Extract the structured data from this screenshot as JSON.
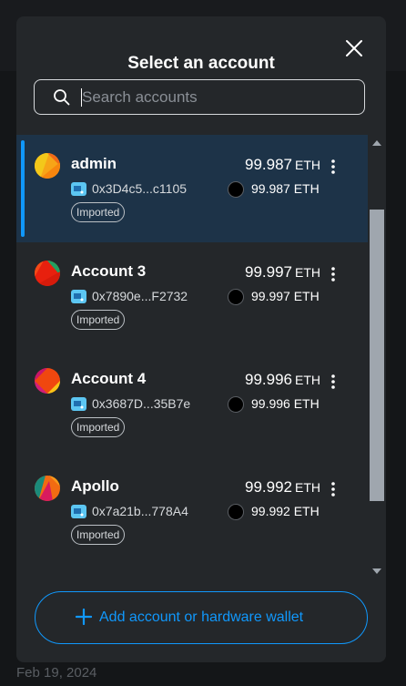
{
  "modal": {
    "title": "Select an account",
    "search_placeholder": "Search accounts",
    "add_button_label": "Add account or hardware wallet"
  },
  "accounts": [
    {
      "name": "admin",
      "balance": "99.987",
      "unit": "ETH",
      "address": "0x3D4c5...c1105",
      "token_balance": "99.987 ETH",
      "tag": "Imported",
      "selected": true
    },
    {
      "name": "Account 3",
      "balance": "99.997",
      "unit": "ETH",
      "address": "0x7890e...F2732",
      "token_balance": "99.997 ETH",
      "tag": "Imported",
      "selected": false
    },
    {
      "name": "Account 4",
      "balance": "99.996",
      "unit": "ETH",
      "address": "0x3687D...35B7e",
      "token_balance": "99.996 ETH",
      "tag": "Imported",
      "selected": false
    },
    {
      "name": "Apollo",
      "balance": "99.992",
      "unit": "ETH",
      "address": "0x7a21b...778A4",
      "token_balance": "99.992 ETH",
      "tag": "Imported",
      "selected": false
    }
  ],
  "background": {
    "date_text": "Feb 19, 2024"
  },
  "icons": {
    "close": "close-icon",
    "search": "search-icon",
    "kebab": "kebab-menu-icon",
    "address": "wallet-address-icon",
    "token": "eth-token-icon",
    "plus": "plus-icon"
  },
  "colors": {
    "accent": "#1098fc",
    "modal_bg": "#24272a",
    "selected_bg": "#1d3348"
  }
}
